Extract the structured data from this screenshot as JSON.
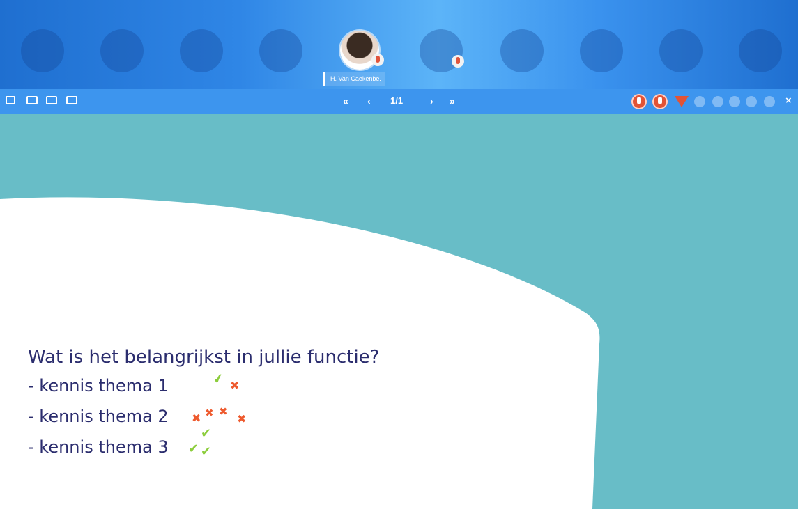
{
  "participants": {
    "presenter_name": "H. Van Caekenbe."
  },
  "toolbar": {
    "left_icons": [
      "whiteboard-icon",
      "screen-share-icon",
      "card-icon",
      "chat-window-icon"
    ],
    "first_label": "«",
    "prev_label": "‹",
    "page_indicator": "1/1",
    "next_label": "›",
    "last_label": "»",
    "right_icons": [
      "mic-icon",
      "speaker-mic-icon",
      "filter-icon",
      "brightness-icon",
      "camera-icon",
      "pencil-icon",
      "fullscreen-icon",
      "close-icon"
    ],
    "close_label": "×"
  },
  "slide": {
    "question": "Wat is het belangrijkst in jullie functie?",
    "items": [
      {
        "text": "- kennis thema 1"
      },
      {
        "text": "- kennis thema 2"
      },
      {
        "text": "- kennis thema 3"
      }
    ],
    "annotations": {
      "check_glyph": "✔",
      "cross_glyph": "✖"
    }
  },
  "colors": {
    "slide_bg": "#68bdc7",
    "text": "#2b2d6e",
    "accent_red": "#e25336",
    "check_green": "#8ccd3c",
    "cross_orange": "#ee5a2e"
  }
}
